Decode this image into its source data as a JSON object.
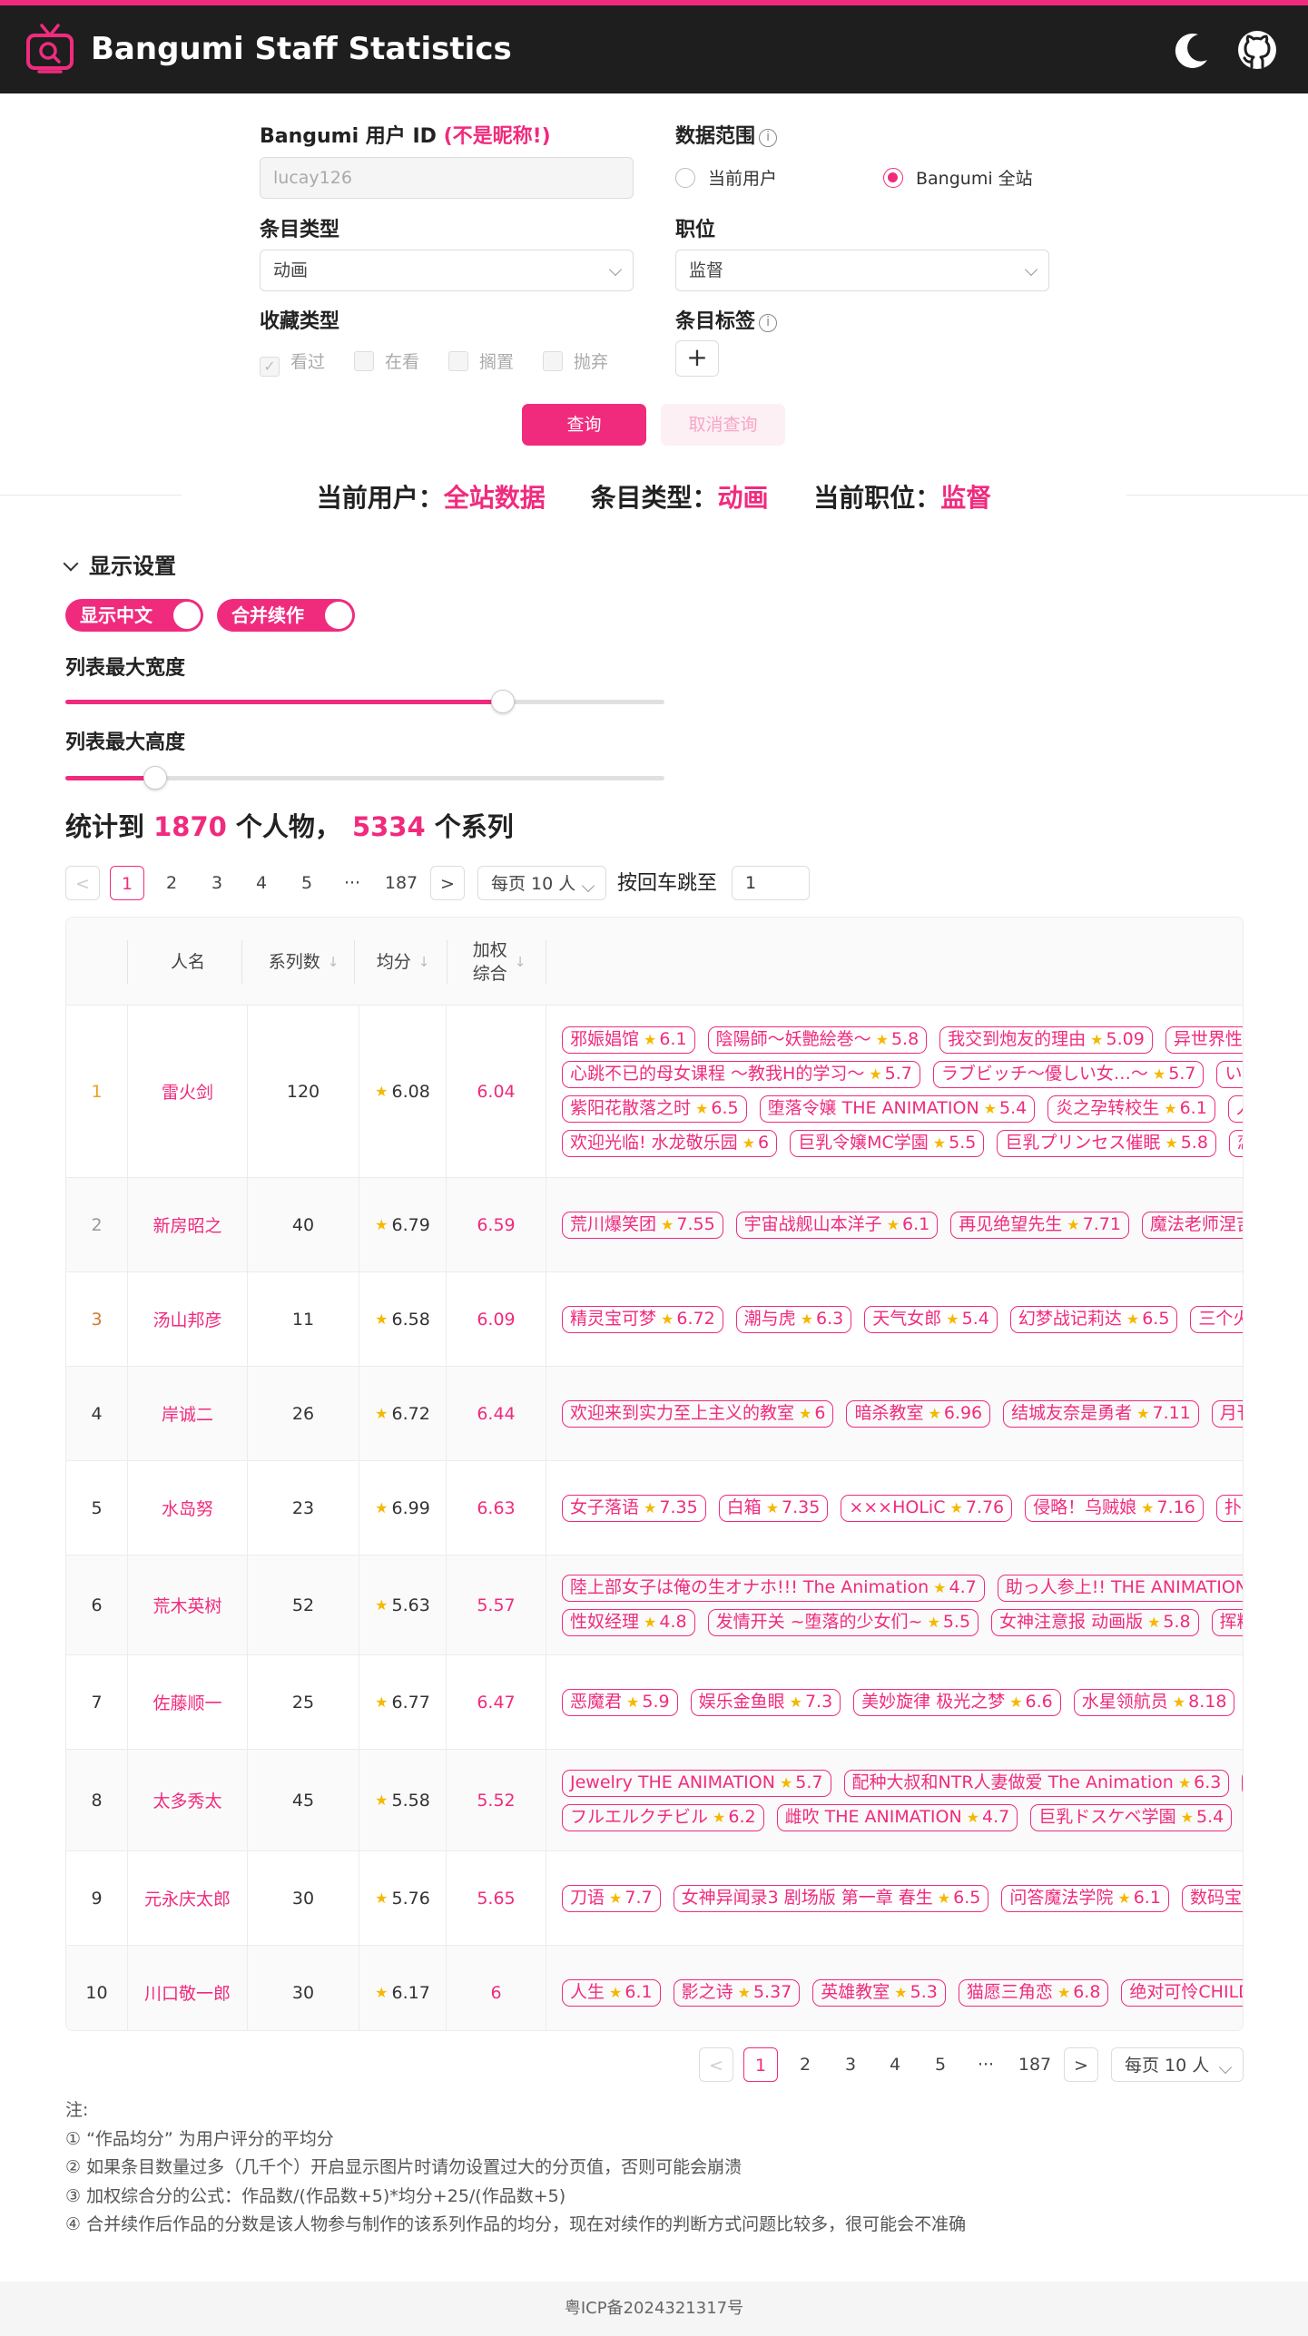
{
  "header": {
    "title": "Bangumi Staff Statistics",
    "icons": [
      "tv-logo-icon",
      "moon-icon",
      "github-icon"
    ],
    "accent": "#f02b7e",
    "bar_color": "#1e1e1e"
  },
  "form": {
    "user_id_label": "Bangumi 用户 ID",
    "user_id_note": "(不是昵称!)",
    "user_id_placeholder": "lucay126",
    "range_label": "数据范围",
    "range_options": [
      "当前用户",
      "Bangumi 全站"
    ],
    "range_selected": "Bangumi 全站",
    "subject_type_label": "条目类型",
    "subject_type_value": "动画",
    "position_label": "职位",
    "position_value": "监督",
    "collection_label": "收藏类型",
    "collection_options": [
      "看过",
      "在看",
      "搁置",
      "抛弃"
    ],
    "tag_label": "条目标签",
    "tag_add": "+",
    "query_button": "查询",
    "cancel_button": "取消查询"
  },
  "summary": {
    "user_label": "当前用户：",
    "user_value": "全站数据",
    "type_label": "条目类型：",
    "type_value": "动画",
    "position_label": "当前职位：",
    "position_value": "监督"
  },
  "display": {
    "title": "显示设置",
    "toggle_chinese": "显示中文",
    "toggle_merge": "合并续作",
    "toggles_on": [
      true,
      true
    ],
    "max_width_label": "列表最大宽度",
    "max_width_level": 0.73,
    "max_height_label": "列表最大高度",
    "max_height_level": 0.15
  },
  "stats": {
    "prefix": "统计到 ",
    "people": "1870",
    "mid": " 个人物，",
    "series": "5334",
    "suffix": " 个系列"
  },
  "pagination": {
    "pages": [
      "1",
      "2",
      "3",
      "4",
      "5",
      "···",
      "187"
    ],
    "current": "1",
    "prev": "<",
    "next": ">",
    "per_page": "每页 10 人",
    "jump_label": "按回车跳至",
    "jump_value": "1"
  },
  "table": {
    "headers": {
      "name": "人名",
      "count": "系列数",
      "avg": "均分",
      "weighted_1": "加权",
      "weighted_2": "综合"
    },
    "rows": [
      {
        "rank": "1",
        "name": "雷火剑",
        "count": "120",
        "avg": "6.08",
        "weighted": "6.04",
        "lines": [
          [
            [
              "邪娠娼馆",
              "6.1"
            ],
            [
              "陰陽師～妖艶絵巻～",
              "5.8"
            ],
            [
              "我交到炮友的理由",
              "5.09"
            ],
            [
              "异世界性",
              ""
            ]
          ],
          [
            [
              "心跳不已的母女课程 ～教我H的学习～",
              "5.7"
            ],
            [
              "ラブビッチ～優しい女…～",
              "5.7"
            ],
            [
              "い",
              ""
            ]
          ],
          [
            [
              "紫阳花散落之时",
              "6.5"
            ],
            [
              "堕落令嬢 THE ANIMATION",
              "5.4"
            ],
            [
              "炎之孕转校生",
              "6.1"
            ],
            [
              "人",
              ""
            ]
          ],
          [
            [
              "欢迎光临! 水龙敬乐园",
              "6"
            ],
            [
              "巨乳令嬢MC学園",
              "5.5"
            ],
            [
              "巨乳プリンセス催眠",
              "5.8"
            ],
            [
              "恋",
              ""
            ]
          ]
        ]
      },
      {
        "rank": "2",
        "name": "新房昭之",
        "count": "40",
        "avg": "6.79",
        "weighted": "6.59",
        "lines": [
          [
            [
              "荒川爆笑团",
              "7.55"
            ],
            [
              "宇宙战舰山本洋子",
              "6.1"
            ],
            [
              "再见绝望先生",
              "7.71"
            ],
            [
              "魔法老师涅吉",
              ""
            ]
          ]
        ]
      },
      {
        "rank": "3",
        "name": "汤山邦彦",
        "count": "11",
        "avg": "6.58",
        "weighted": "6.09",
        "lines": [
          [
            [
              "精灵宝可梦",
              "6.72"
            ],
            [
              "潮与虎",
              "6.3"
            ],
            [
              "天气女郎",
              "5.4"
            ],
            [
              "幻梦战记莉达",
              "6.5"
            ],
            [
              "三个火",
              ""
            ]
          ]
        ]
      },
      {
        "rank": "4",
        "name": "岸诚二",
        "count": "26",
        "avg": "6.72",
        "weighted": "6.44",
        "lines": [
          [
            [
              "欢迎来到实力至上主义的教室",
              "6"
            ],
            [
              "暗杀教室",
              "6.96"
            ],
            [
              "结城友奈是勇者",
              "7.11"
            ],
            [
              "月刊",
              ""
            ]
          ]
        ]
      },
      {
        "rank": "5",
        "name": "水岛努",
        "count": "23",
        "avg": "6.99",
        "weighted": "6.63",
        "lines": [
          [
            [
              "女子落语",
              "7.35"
            ],
            [
              "白箱",
              "7.35"
            ],
            [
              "×××HOLiC",
              "7.76"
            ],
            [
              "侵略！乌贼娘",
              "7.16"
            ],
            [
              "扑杀",
              ""
            ]
          ]
        ]
      },
      {
        "rank": "6",
        "name": "荒木英树",
        "count": "52",
        "avg": "5.63",
        "weighted": "5.57",
        "lines": [
          [
            [
              "陸上部女子は俺の生オナホ!!! The Animation",
              "4.7"
            ],
            [
              "助っ人参上!! THE ANIMATION",
              ""
            ]
          ],
          [
            [
              "性奴经理",
              "4.8"
            ],
            [
              "发情开关 ~堕落的少女们~",
              "5.5"
            ],
            [
              "女神注意报 动画版",
              "5.8"
            ],
            [
              "挥精",
              ""
            ]
          ]
        ]
      },
      {
        "rank": "7",
        "name": "佐藤顺一",
        "count": "25",
        "avg": "6.77",
        "weighted": "6.47",
        "lines": [
          [
            [
              "恶魔君",
              "5.9"
            ],
            [
              "娱乐金鱼眼",
              "7.3"
            ],
            [
              "美妙旋律 极光之梦",
              "6.6"
            ],
            [
              "水星领航员",
              "8.18"
            ]
          ]
        ]
      },
      {
        "rank": "8",
        "name": "太多秀太",
        "count": "45",
        "avg": "5.58",
        "weighted": "5.52",
        "lines": [
          [
            [
              "Jewelry THE ANIMATION",
              "5.7"
            ],
            [
              "配种大叔和NTR人妻做爱 The Animation",
              "6.3"
            ],
            [
              "",
              ""
            ]
          ],
          [
            [
              "フルエルクチビル",
              "6.2"
            ],
            [
              "雌吹 THE ANIMATION",
              "4.7"
            ],
            [
              "巨乳ドスケベ学園",
              "5.4"
            ]
          ]
        ]
      },
      {
        "rank": "9",
        "name": "元永庆太郎",
        "count": "30",
        "avg": "5.76",
        "weighted": "5.65",
        "lines": [
          [
            [
              "刀语",
              "7.7"
            ],
            [
              "女神异闻录3 剧场版 第一章 春生",
              "6.5"
            ],
            [
              "问答魔法学院",
              "6.1"
            ],
            [
              "数码宝",
              ""
            ]
          ]
        ]
      },
      {
        "rank": "10",
        "name": "川口敬一郎",
        "count": "30",
        "avg": "6.17",
        "weighted": "6",
        "lines": [
          [
            [
              "人生",
              "6.1"
            ],
            [
              "影之诗",
              "5.37"
            ],
            [
              "英雄教室",
              "5.3"
            ],
            [
              "猫愿三角恋",
              "6.8"
            ],
            [
              "绝对可怜CHILD",
              ""
            ]
          ]
        ]
      }
    ]
  },
  "notes": [
    "注:",
    "① “作品均分” 为用户评分的平均分",
    "② 如果条目数量过多（几千个）开启显示图片时请勿设置过大的分页值，否则可能会崩溃",
    "③ 加权综合分的公式：作品数/(作品数+5)*均分+25/(作品数+5)",
    "④ 合并续作后作品的分数是该人物参与制作的该系列作品的均分，现在对续作的判断方式问题比较多，很可能会不准确"
  ],
  "footer": "粤ICP备2024321317号"
}
